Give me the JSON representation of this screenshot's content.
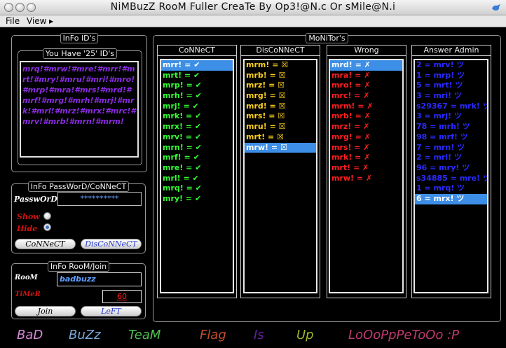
{
  "window": {
    "title": "NiMBuzZ RooM Fuller CreaTe By Op3!@N.c Or sMile@N.i"
  },
  "menu": {
    "file": "File",
    "view": "View"
  },
  "info_ids": {
    "group_title": "InFo ID's",
    "count_label": "You Have '25' ID's",
    "ids_text": "mrq!#mrw!#mre!#mrr!#mrt!#mry!#mru!#mri!#mro!#mrp!#mra!#mrs!#mrd!#mrf!#mrg!#mrh!#mrj!#mrk!#mrl!#mrz!#mrx!#mrc!#mrv!#mrb!#mrn!#mrm!"
  },
  "info_password": {
    "group_title": "InFo PassWorD/CoNNeCT",
    "password_label": "PasswOrD",
    "password_value": "**********",
    "show_label": "Show",
    "hide_label": "Hide",
    "selected": "hide",
    "connect_button": "CoNNeCT",
    "disconnect_button": "DisCoNNeCT"
  },
  "info_room": {
    "group_title": "InFo RooM/Join",
    "room_label": "RooM",
    "room_value": "badbuzz",
    "timer_label": "TiMeR",
    "timer_value": "60",
    "join_button": "Join",
    "left_button": "LeFT"
  },
  "monitor": {
    "group_title": "MoNiTor's",
    "connect": {
      "title": "CoNNeCT",
      "color": "#33ff33",
      "rows": [
        "mrr! = ✔",
        "mrt! = ✔",
        "mrp! = ✔",
        "mrh! = ✔",
        "mrj! = ✔",
        "mrk! = ✔",
        "mrx! = ✔",
        "mrv! = ✔",
        "mrn! = ✔",
        "mrf! = ✔",
        "mre! = ✔",
        "mrl! = ✔",
        "mrq! = ✔",
        "mry! = ✔"
      ],
      "selected_index": 0
    },
    "disconnect": {
      "title": "DisCoNNeCT",
      "color": "#ffd21a",
      "rows": [
        "mrm! = ☒",
        "mrb! = ☒",
        "mrz! = ☒",
        "mrg! = ☒",
        "mrd! = ☒",
        "mrs! = ☒",
        "mru! = ☒",
        "mrt! = ☒",
        "mrw! = ☒"
      ],
      "selected_index": 8
    },
    "wrong": {
      "title": "Wrong",
      "color": "#ff2020",
      "rows": [
        "mrd! = ✗",
        "mra! = ✗",
        "mro! = ✗",
        "mrc! = ✗",
        "mrm! = ✗",
        "mrb! = ✗",
        "mrz! = ✗",
        "mrg! = ✗",
        "mrs! = ✗",
        "mrk! = ✗",
        "mrt! = ✗",
        "mrw! = ✗"
      ],
      "selected_index": 0
    },
    "answer": {
      "title": "Answer Admin",
      "color": "#2a2aff",
      "rows": [
        "2 = mrv! ツ",
        "1 = mrp! ツ",
        "5 = mrt! ツ",
        "3 = mri! ツ",
        "s29367 = mrk! ツ",
        "3 = mrj! ツ",
        "78 = mrh! ツ",
        "98 = mrf! ツ",
        "7 = mrn! ツ",
        "2 = mri! ツ",
        "96 = mry! ツ",
        "s34885 = mre! ツ",
        "1 = mrq! ツ",
        "6 = mrx! ツ"
      ],
      "selected_index": 13
    }
  },
  "footer": {
    "words": [
      {
        "text": "BaD",
        "color": "#d68ad6"
      },
      {
        "text": "BuZz",
        "color": "#7aa7d8"
      },
      {
        "text": "TeaM",
        "color": "#4fbf4f"
      },
      {
        "text": "Flag",
        "color": "#c0502a"
      },
      {
        "text": "Is",
        "color": "#6a1fa0"
      },
      {
        "text": "Up",
        "color": "#9bb82a"
      },
      {
        "text": "LoOoPpPeToOo :P",
        "color": "#c03a6e"
      }
    ]
  }
}
